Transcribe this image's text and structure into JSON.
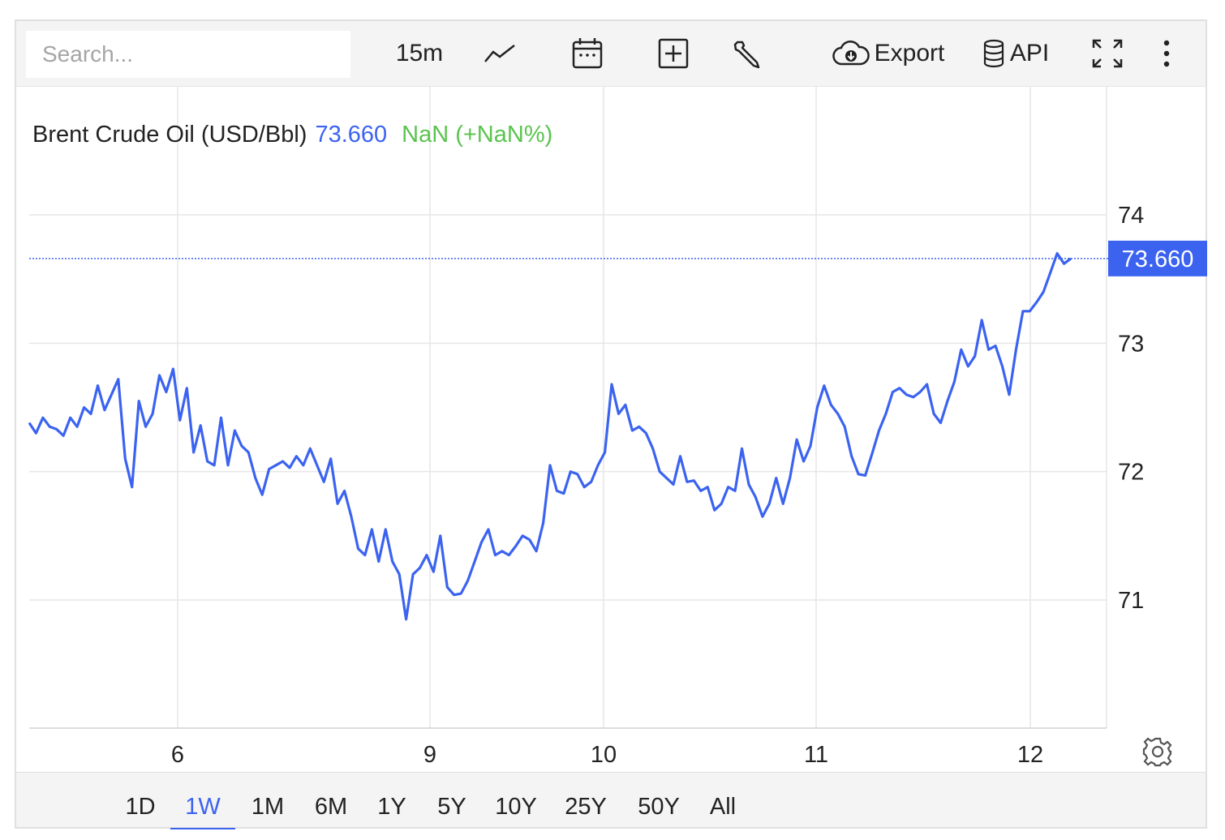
{
  "toolbar": {
    "search_placeholder": "Search...",
    "interval_label": "15m",
    "export_label": "Export",
    "api_label": "API",
    "icons": [
      "line-chart-icon",
      "calendar-icon",
      "plus-box-icon",
      "wrench-icon",
      "cloud-download-icon",
      "database-icon",
      "fullscreen-icon",
      "more-vertical-icon"
    ]
  },
  "legend": {
    "name": "Brent Crude Oil (USD/Bbl)",
    "last": "73.660",
    "change": "NaN (+NaN%)"
  },
  "colors": {
    "line": "#3b63f0",
    "change_positive": "#5ac44e",
    "grid": "#e6e6e6",
    "background": "#ffffff"
  },
  "range": {
    "items": [
      "1D",
      "1W",
      "1M",
      "6M",
      "1Y",
      "5Y",
      "10Y",
      "25Y",
      "50Y",
      "All"
    ],
    "active": "1W"
  },
  "chart_data": {
    "type": "line",
    "title": "Brent Crude Oil (USD/Bbl)",
    "xlabel": "",
    "ylabel": "",
    "ylim": [
      70,
      74.8
    ],
    "y_ticks": [
      71,
      72,
      73,
      74
    ],
    "y_tick_labels": [
      "71",
      "72",
      "73",
      "74"
    ],
    "x_tick_labels": [
      "6",
      "9",
      "10",
      "11",
      "12"
    ],
    "last_value_label": "73.660",
    "last_value": 73.66,
    "grid": true,
    "series": [
      {
        "name": "Brent Crude Oil (USD/Bbl)",
        "values": [
          72.38,
          72.3,
          72.42,
          72.35,
          72.33,
          72.28,
          72.42,
          72.35,
          72.5,
          72.45,
          72.67,
          72.48,
          72.6,
          72.72,
          72.1,
          71.88,
          72.55,
          72.35,
          72.45,
          72.75,
          72.62,
          72.8,
          72.4,
          72.65,
          72.15,
          72.36,
          72.08,
          72.05,
          72.42,
          72.05,
          72.32,
          72.2,
          72.15,
          71.95,
          71.82,
          72.02,
          72.05,
          72.08,
          72.03,
          72.12,
          72.05,
          72.18,
          72.05,
          71.92,
          72.1,
          71.75,
          71.85,
          71.65,
          71.4,
          71.35,
          71.55,
          71.3,
          71.55,
          71.3,
          71.2,
          70.85,
          71.2,
          71.25,
          71.35,
          71.22,
          71.5,
          71.1,
          71.04,
          71.05,
          71.15,
          71.3,
          71.45,
          71.55,
          71.35,
          71.38,
          71.35,
          71.42,
          71.5,
          71.47,
          71.38,
          71.6,
          72.05,
          71.85,
          71.83,
          72.0,
          71.98,
          71.88,
          71.92,
          72.05,
          72.15,
          72.68,
          72.45,
          72.52,
          72.32,
          72.35,
          72.3,
          72.18,
          72.0,
          71.95,
          71.9,
          72.12,
          71.92,
          71.93,
          71.85,
          71.88,
          71.7,
          71.75,
          71.88,
          71.85,
          72.18,
          71.9,
          71.8,
          71.65,
          71.75,
          71.95,
          71.75,
          71.95,
          72.25,
          72.08,
          72.2,
          72.5,
          72.67,
          72.52,
          72.45,
          72.35,
          72.12,
          71.98,
          71.97,
          72.14,
          72.32,
          72.45,
          72.62,
          72.65,
          72.6,
          72.58,
          72.62,
          72.68,
          72.45,
          72.38,
          72.55,
          72.7,
          72.95,
          72.82,
          72.9,
          73.18,
          72.95,
          72.98,
          72.82,
          72.6,
          72.95,
          73.25,
          73.25,
          73.32,
          73.4,
          73.55,
          73.7,
          73.62,
          73.66
        ]
      }
    ]
  }
}
